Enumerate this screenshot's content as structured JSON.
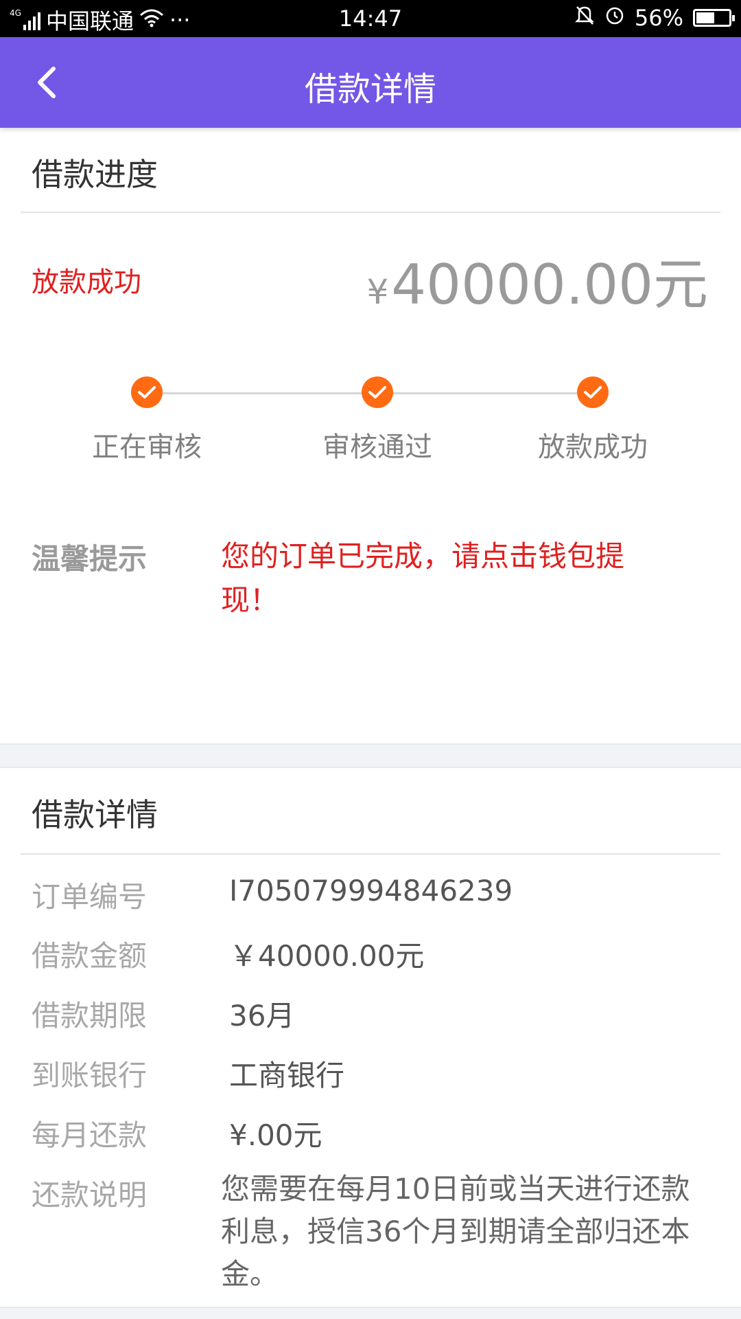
{
  "status_bar": {
    "network": "4G",
    "carrier": "中国联通",
    "dots": "···",
    "time": "14:47",
    "battery": "56%",
    "battery_level": 0.56
  },
  "header": {
    "title": "借款详情"
  },
  "progress_section": {
    "title": "借款进度",
    "status": "放款成功",
    "amount_currency": "¥",
    "amount_value": "40000.00元",
    "steps": [
      {
        "label": "正在审核"
      },
      {
        "label": "审核通过"
      },
      {
        "label": "放款成功"
      }
    ],
    "tip_label": "温馨提示",
    "tip_text": "您的订单已完成，请点击钱包提现！"
  },
  "detail_section": {
    "title": "借款详情",
    "rows": [
      {
        "label": "订单编号",
        "value": "I7050799948462​39"
      },
      {
        "label": "借款金额",
        "value": "￥40000.00元"
      },
      {
        "label": "借款期限",
        "value": "36月"
      },
      {
        "label": "到账银行",
        "value": "工商银行"
      },
      {
        "label": "每月还款",
        "value": "¥.00元"
      },
      {
        "label": "还款说明",
        "value": "您需要在每月10日前或当天进行还款利息，授信36个月到期请全部归还本金。"
      }
    ]
  },
  "colors": {
    "header_bg": "#7357e6",
    "status_red": "#e02020",
    "step_orange": "#ff6a13"
  }
}
